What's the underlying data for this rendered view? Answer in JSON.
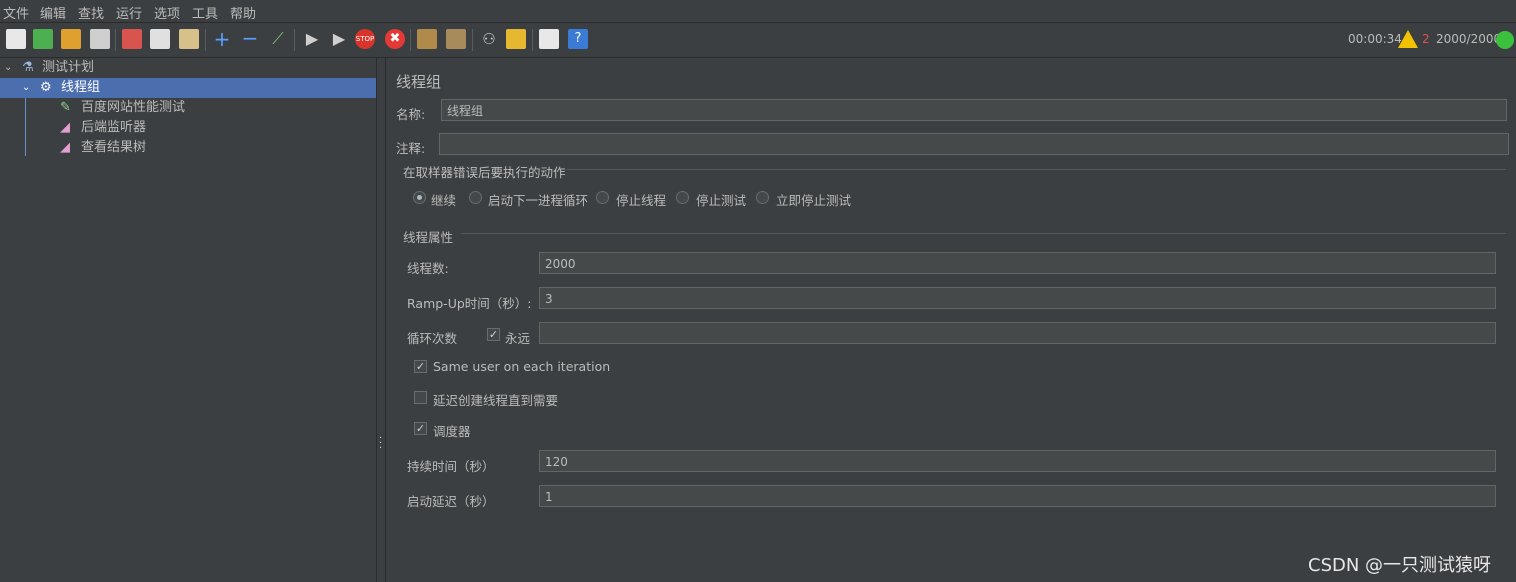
{
  "menu": [
    "文件",
    "编辑",
    "查找",
    "运行",
    "选项",
    "工具",
    "帮助"
  ],
  "status": {
    "elapsed": "00:00:34",
    "warnings": "2",
    "threads": "2000/2000"
  },
  "tree": {
    "plan": "测试计划",
    "thread_group": "线程组",
    "children": [
      "百度网站性能测试",
      "后端监听器",
      "查看结果树"
    ]
  },
  "panel": {
    "title": "线程组",
    "name_label": "名称:",
    "name_value": "线程组",
    "comment_label": "注释:",
    "comment_value": "",
    "error_section": "在取样器错误后要执行的动作",
    "error_options": [
      "继续",
      "启动下一进程循环",
      "停止线程",
      "停止测试",
      "立即停止测试"
    ],
    "error_selected": "继续",
    "props_section": "线程属性",
    "threads_label": "线程数:",
    "threads_value": "2000",
    "rampup_label": "Ramp-Up时间（秒）:",
    "rampup_value": "3",
    "loop_label": "循环次数",
    "forever_label": "永远",
    "loop_value": "",
    "same_user_label": "Same user on each iteration",
    "delay_create_label": "延迟创建线程直到需要",
    "scheduler_label": "调度器",
    "duration_label": "持续时间（秒）",
    "duration_value": "120",
    "startup_delay_label": "启动延迟（秒）",
    "startup_delay_value": "1"
  },
  "watermark": "CSDN @一只测试猿呀",
  "colors": {
    "bg": "#3c3f41",
    "selection": "#4b6eaf",
    "field": "#45494a"
  }
}
